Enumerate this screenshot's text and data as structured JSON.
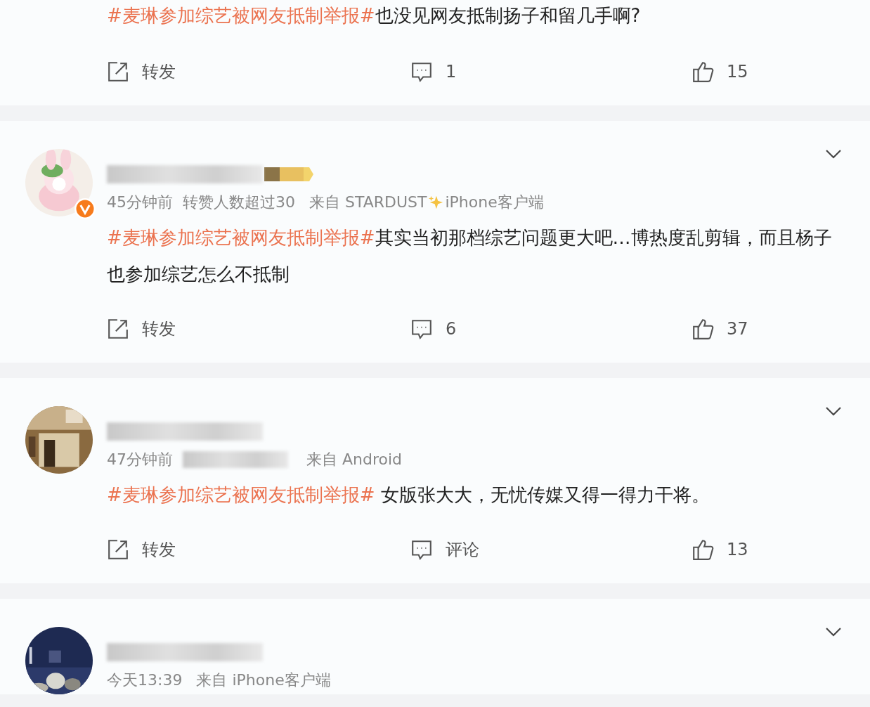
{
  "posts": [
    {
      "topic": "#麦琳参加综艺被网友抵制举报#",
      "text": "也没见网友抵制扬子和留几手啊?",
      "actions": {
        "repost": "转发",
        "comment": "1",
        "like": "15"
      }
    },
    {
      "avatar": {
        "kind": "picture",
        "verified": true
      },
      "name_hidden": true,
      "member_badge": true,
      "expand": true,
      "time": "45分钟前",
      "stat": "转赞人数超过30",
      "source": "来自 STARDUST",
      "source_sparkle": true,
      "device": "iPhone客户端",
      "topic": "#麦琳参加综艺被网友抵制举报#",
      "text": "其实当初那档综艺问题更大吧…博热度乱剪辑，而且杨子也参加综艺怎么不抵制",
      "actions": {
        "repost": "转发",
        "comment": "6",
        "like": "37"
      }
    },
    {
      "avatar": {
        "kind": "picture"
      },
      "name_hidden": true,
      "expand": true,
      "time": "47分钟前",
      "stat_hidden": true,
      "source": "来自 Android",
      "topic": "#麦琳参加综艺被网友抵制举报#",
      "text": " 女版张大大，无忧传媒又得一得力干将。",
      "actions": {
        "repost": "转发",
        "comment": "评论",
        "like": "13"
      }
    },
    {
      "avatar": {
        "kind": "picture"
      },
      "name_hidden": true,
      "expand": true,
      "time": "今天13:39",
      "source": "来自 iPhone客户端"
    }
  ]
}
